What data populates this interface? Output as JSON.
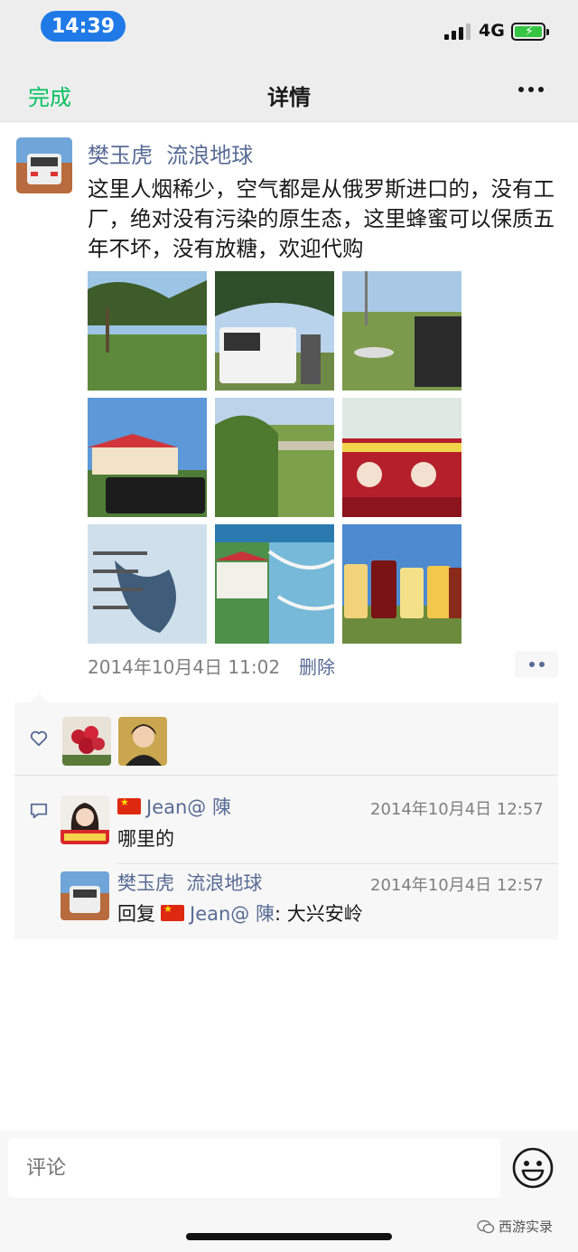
{
  "status_bar": {
    "time": "14:39",
    "network": "4G"
  },
  "nav": {
    "done_label": "完成",
    "title": "详情",
    "more_icon": "more-icon"
  },
  "post": {
    "author": "樊玉虎  流浪地球",
    "text": "这里人烟稀少，空气都是从俄罗斯进口的，没有工厂，绝对没有污染的原生态，这里蜂蜜可以保质五年不坏，没有放糖，欢迎代购",
    "time": "2014年10月4日 11:02",
    "delete_label": "删除"
  },
  "comments": [
    {
      "name": "Jean@ 陳",
      "time": "2014年10月4日 12:57",
      "text": "哪里的"
    },
    {
      "name": "樊玉虎  流浪地球",
      "time": "2014年10月4日 12:57",
      "reply_prefix": "回复",
      "reply_to": "Jean@ 陳",
      "text": ": 大兴安岭"
    }
  ],
  "composer": {
    "placeholder": "评论"
  },
  "watermark": {
    "text": "西游实录"
  },
  "colors": {
    "accent_green": "#07c160",
    "link_blue": "#576b95",
    "time_pill": "#1f7ae8"
  }
}
